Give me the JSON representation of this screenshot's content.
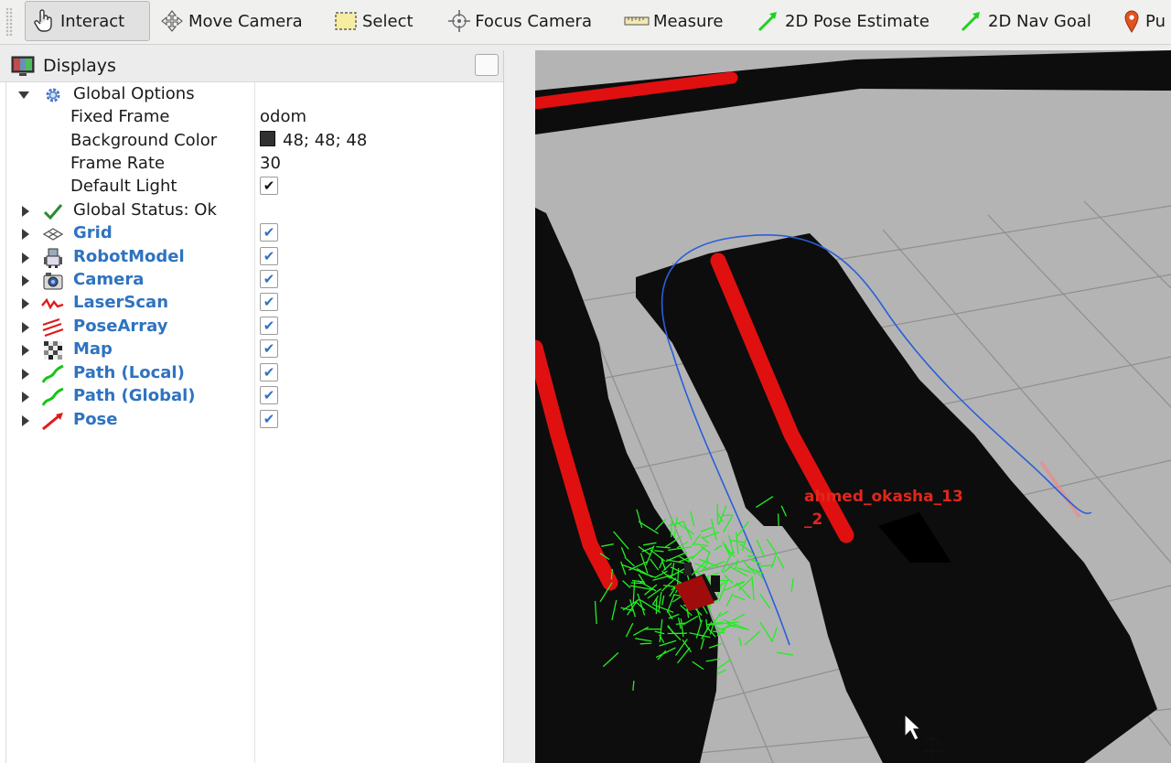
{
  "toolbar": {
    "tools": [
      {
        "label": "Interact",
        "icon": "hand-pointer-icon",
        "active": true
      },
      {
        "label": "Move Camera",
        "icon": "move-camera-icon"
      },
      {
        "label": "Select",
        "icon": "select-box-icon"
      },
      {
        "label": "Focus Camera",
        "icon": "focus-camera-icon"
      },
      {
        "label": "Measure",
        "icon": "ruler-icon"
      },
      {
        "label": "2D Pose Estimate",
        "icon": "green-arrow-icon"
      },
      {
        "label": "2D Nav Goal",
        "icon": "green-arrow-icon"
      },
      {
        "label": "Pu",
        "icon": "map-pin-icon"
      }
    ]
  },
  "displays": {
    "title": "Displays",
    "global_options": {
      "label": "Global Options",
      "fixed_frame": {
        "label": "Fixed Frame",
        "value": "odom"
      },
      "background_color": {
        "label": "Background Color",
        "value": "48; 48; 48",
        "swatch": "#303030"
      },
      "frame_rate": {
        "label": "Frame Rate",
        "value": "30"
      },
      "default_light": {
        "label": "Default Light",
        "checked": true
      }
    },
    "global_status": {
      "label": "Global Status: Ok"
    },
    "items": [
      {
        "label": "Grid",
        "icon": "grid-icon",
        "checked": true
      },
      {
        "label": "RobotModel",
        "icon": "robot-model-icon",
        "checked": true
      },
      {
        "label": "Camera",
        "icon": "camera-icon",
        "checked": true
      },
      {
        "label": "LaserScan",
        "icon": "laserscan-icon",
        "checked": true
      },
      {
        "label": "PoseArray",
        "icon": "posearray-icon",
        "checked": true
      },
      {
        "label": "Map",
        "icon": "map-icon",
        "checked": true
      },
      {
        "label": "Path (Local)",
        "icon": "path-icon",
        "checked": true
      },
      {
        "label": "Path (Global)",
        "icon": "path-icon",
        "checked": true
      },
      {
        "label": "Pose",
        "icon": "pose-arrow-icon",
        "checked": true
      }
    ]
  },
  "viewport": {
    "robot_label_line1": "ahmed_okasha_13",
    "robot_label_line2": "_2",
    "colors": {
      "floor": "#b4b4b4",
      "grid": "#8f8f8f",
      "map": "#0d0d0d",
      "laser": "#e01010",
      "poses": "#22ee22",
      "path": "#2a5fd8",
      "label": "#e1261c"
    }
  }
}
